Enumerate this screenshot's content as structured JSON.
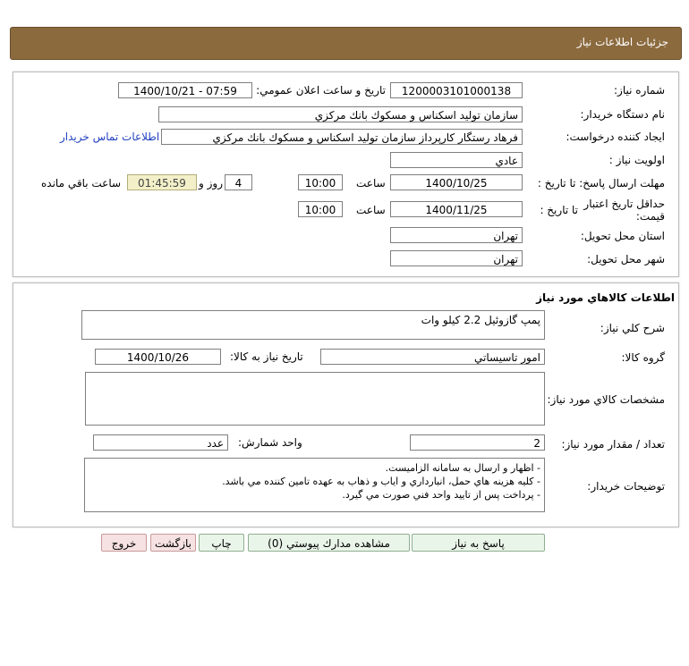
{
  "header": {
    "title": "جزئيات اطلاعات نياز"
  },
  "info": {
    "need_number_label": "شماره نياز:",
    "need_number": "1200003101000138",
    "announce_label": "تاريخ و ساعت اعلان عمومي:",
    "announce_value": "1400/10/21 - 07:59",
    "buyer_org_label": "نام دستگاه خريدار:",
    "buyer_org": "سازمان توليد اسكناس و مسكوك بانك مركزي",
    "requester_label": "ايجاد كننده درخواست:",
    "requester": "فرهاد رستگار كارپرداز سازمان توليد اسكناس و مسكوك بانك مركزي",
    "contact_link": "اطلاعات تماس خريدار",
    "priority_label": "اولويت نياز :",
    "priority": "عادي",
    "deadline_label": "مهلت ارسال پاسخ: تا تاريخ :",
    "deadline_date": "1400/10/25",
    "time_label": "ساعت",
    "deadline_time": "10:00",
    "days_value": "4",
    "days_label": "روز و",
    "remaining_value": "01:45:59",
    "remaining_label": "ساعت باقي مانده",
    "validity_label_1": "حداقل تاريخ اعتبار",
    "validity_label_2": "قيمت:",
    "validity_to_label": "تا تاريخ :",
    "validity_date": "1400/11/25",
    "validity_time": "10:00",
    "province_label": "استان محل تحويل:",
    "province": "تهران",
    "city_label": "شهر محل تحويل:",
    "city": "تهران"
  },
  "goods": {
    "section_title": "اطلاعات كالاهاي مورد نياز",
    "desc_label": "شرح كلي نياز:",
    "desc": "پمپ گازوئيل 2.2 كيلو وات",
    "group_label": "گروه كالا:",
    "group": "امور تاسيساتي",
    "need_date_label": "تاريخ نياز به كالا:",
    "need_date": "1400/10/26",
    "spec_label": "مشخصات كالاي مورد نياز:",
    "spec": "",
    "qty_label": "تعداد / مقدار مورد نياز:",
    "qty": "2",
    "unit_label": "واحد شمارش:",
    "unit": "عدد",
    "notes_label": "توضيحات خريدار:",
    "notes": [
      "- اظهار و ارسال به سامانه الزاميست.",
      "- كليه هزينه هاي حمل، انبارداري و اياب و ذهاب به عهده تامين كننده مي باشد.",
      "- پرداخت پس از تاييد واحد فني صورت مي گيرد."
    ]
  },
  "buttons": {
    "reply": "پاسخ به نياز",
    "docs": "مشاهده مدارك پيوستي (0)",
    "print": "چاپ",
    "back": "بازگشت",
    "exit": "خروج"
  }
}
